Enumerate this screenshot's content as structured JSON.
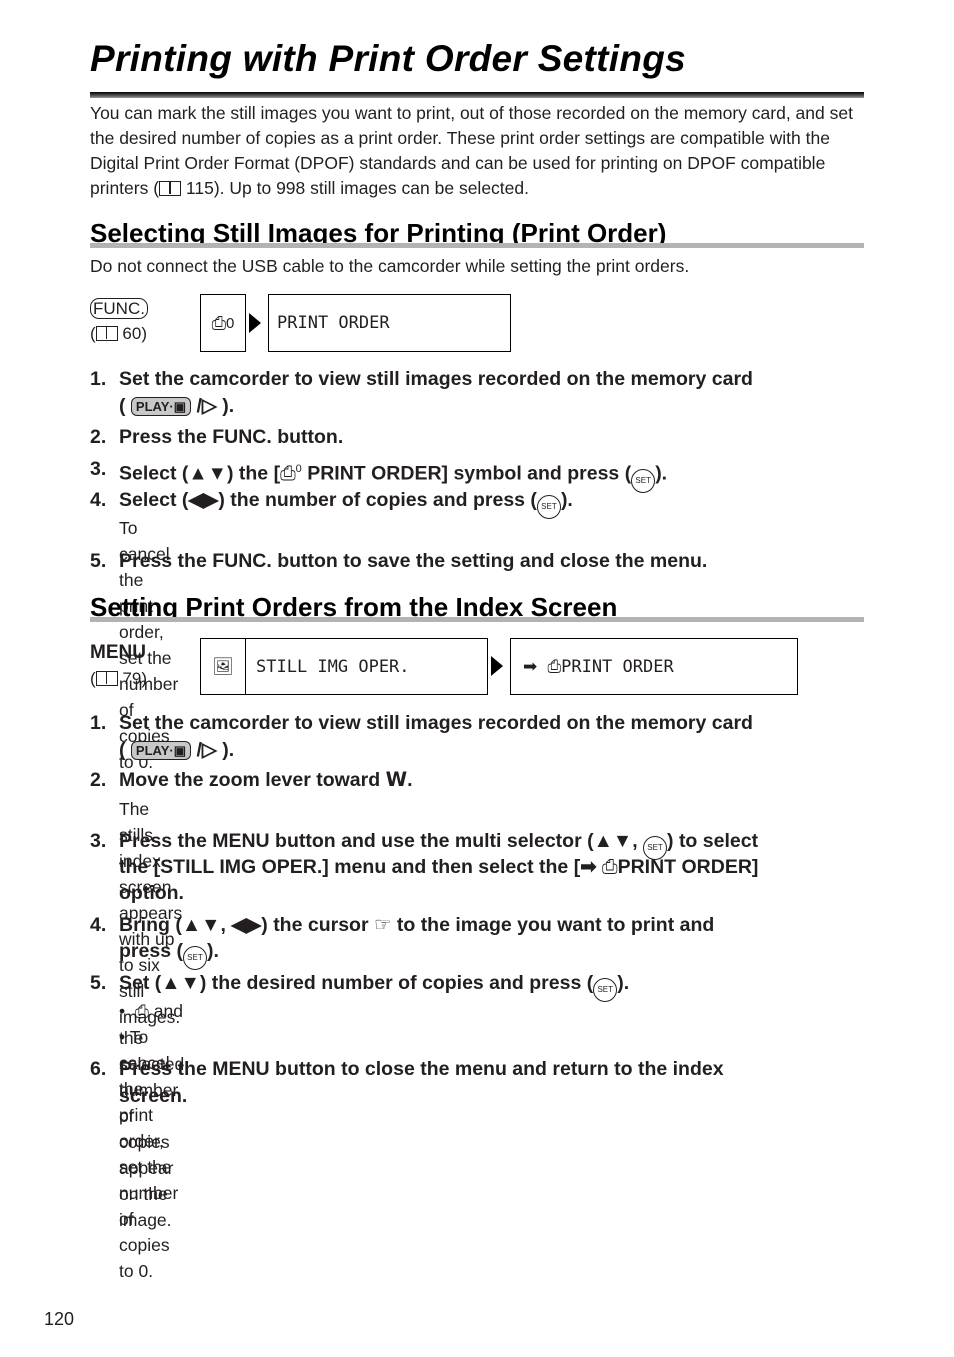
{
  "page": {
    "title": "Printing with Print Order Settings",
    "intro": "You can mark the still images you want to print, out of those recorded on the memory card, and set the desired number of copies as a print order. These print order settings are compatible with the Digital Print Order Format (DPOF) standards and can be used for printing on DPOF compatible printers (",
    "intro_ref": "115",
    "intro_tail": "). Up to 998 still images can be selected.",
    "page_number": "120"
  },
  "section1": {
    "heading": "Selecting Still Images for Printing (Print Order)",
    "note": "Do not connect the USB cable to the camcorder while setting the print orders.",
    "button_label": "FUNC.",
    "ref": "60",
    "lcd_icon_suffix": "0",
    "lcd_item": "PRINT ORDER",
    "steps": [
      {
        "num": "1.",
        "text": "Set the camcorder to view still images recorded on the memory card",
        "line2_play": "PLAY·",
        "line2_end": ")."
      },
      {
        "num": "2.",
        "text": "Press the FUNC. button."
      },
      {
        "num": "3.",
        "pre": "Select (",
        "arrows": "▲▼",
        "mid": ") the [",
        "sym_suffix": "0",
        "post": " PRINT ORDER] symbol and press (",
        "set": "SET",
        "end": ")."
      },
      {
        "num": "4.",
        "pre": "Select (",
        "arrows": "◀▶",
        "post": ") the number of copies and press (",
        "set": "SET",
        "end": ").",
        "sub": "To cancel the print order, set the number of copies to 0."
      },
      {
        "num": "5.",
        "text": "Press the FUNC. button to save the setting and close the menu."
      }
    ]
  },
  "section2": {
    "heading": "Setting Print Orders from the Index Screen",
    "button_label": "MENU",
    "ref": "79",
    "lcd_menu": "STILL IMG OPER.",
    "lcd_item": "PRINT ORDER",
    "steps": [
      {
        "num": "1.",
        "text": "Set the camcorder to view still images recorded on the memory card",
        "line2_play": "PLAY·",
        "line2_end": ")."
      },
      {
        "num": "2.",
        "text": "Move the zoom lever toward ",
        "w": "W",
        "end": ".",
        "sub": "The stills index screen appears with up to six still images."
      },
      {
        "num": "3.",
        "l1_pre": "Press the MENU button and use the multi selector (",
        "arrows": "▲▼",
        "l1_post": ", ",
        "set": "SET",
        "l1_end": ") to select",
        "l2_pre": "the [STILL IMG OPER.] menu and then select the [",
        "l2_post": "PRINT ORDER]",
        "l3": "option."
      },
      {
        "num": "4.",
        "l1_pre": "Bring (",
        "arrows1": "▲▼",
        "comma": ", ",
        "arrows2": "◀▶",
        "l1_mid": ") the cursor ",
        "l1_post": " to the image you want to print and",
        "l2_pre": "press (",
        "set": "SET",
        "l2_end": ")."
      },
      {
        "num": "5.",
        "pre": "Set (",
        "arrows": "▲▼",
        "post": ") the desired number of copies and press (",
        "set": "SET",
        "end": ").",
        "bullets": [
          "and the selected number of copies appear on the image.",
          "To cancel the print order, set the number of copies to 0."
        ]
      },
      {
        "num": "6.",
        "text": "Press the MENU button to close the menu and return to the index",
        "line2": "screen."
      }
    ]
  }
}
